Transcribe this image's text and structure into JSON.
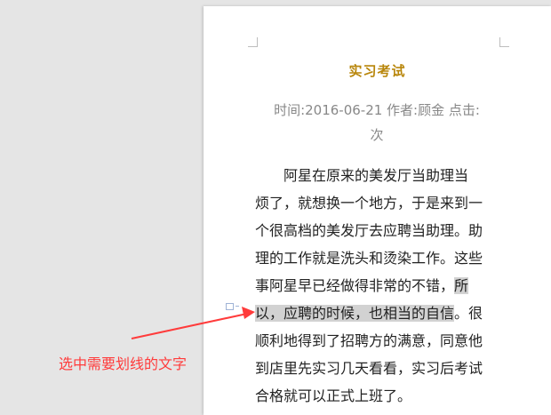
{
  "document": {
    "title": "实习考试",
    "meta_line1": "时间:2016-06-21  作者:顾金  点击:",
    "meta_line2": "次",
    "lines": {
      "l1": "阿星在原来的美发厅当助理当",
      "l2": "烦了，就想换一个地方，于是来到一",
      "l3": "个很高档的美发厅去应聘当助理。助",
      "l4": "理的工作就是洗头和烫染工作。这些",
      "l5a": "事阿星早已经做得非常的不错，",
      "l5b": "所",
      "l6a": "以，应聘的时候，也相当的自信",
      "l6b": "。很",
      "l7": "顺利地得到了招聘方的满意，同意他",
      "l8": "到店里先实习几天看看，实习后考试",
      "l9": "合格就可以正式上班了。"
    }
  },
  "annotation": {
    "text": "选中需要划线的文字",
    "color": "#ff3b3b"
  },
  "colors": {
    "title": "#b8860b",
    "selection": "#d2d2d2",
    "workspace": "#e5e5e5"
  }
}
